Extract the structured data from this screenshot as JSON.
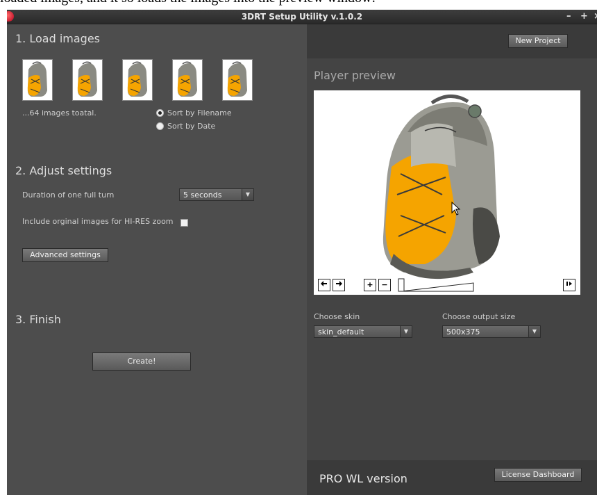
{
  "caption": "loaded images, and it so loads the images into the preview window:",
  "window": {
    "title": "3DRT Setup Utility v.1.0.2",
    "controls": {
      "minimize": "–",
      "maximize": "+",
      "close": "×"
    }
  },
  "load_images": {
    "title": "1. Load images",
    "thumbnail_count_shown": 5,
    "count_text": "...64 images toatal.",
    "sort_options": [
      {
        "label": "Sort by Filename",
        "selected": true
      },
      {
        "label": "Sort by Date",
        "selected": false
      }
    ]
  },
  "adjust_settings": {
    "title": "2. Adjust settings",
    "duration_label": "Duration of one full turn",
    "duration_value": "5 seconds",
    "hires_label": "Include orginal images for HI-RES zoom",
    "hires_checked": false,
    "advanced_button": "Advanced settings"
  },
  "finish": {
    "title": "3. Finish",
    "create_button": "Create!"
  },
  "right": {
    "new_project_button": "New Project",
    "preview_title": "Player preview",
    "controls": {
      "left_arrow": "◀",
      "right_arrow": "▶",
      "zoom_in": "+",
      "zoom_out": "−",
      "zoom_level": 0.0,
      "play": "▶"
    },
    "skin_label": "Choose skin",
    "skin_value": "skin_default",
    "size_label": "Choose output size",
    "size_value": "500x375",
    "pro_label": "PRO WL version",
    "license_button": "License Dashboard"
  },
  "colors": {
    "backpack_orange": "#f5a400",
    "backpack_gray": "#8a8a82",
    "pane_dark": "#4d4d4d"
  }
}
